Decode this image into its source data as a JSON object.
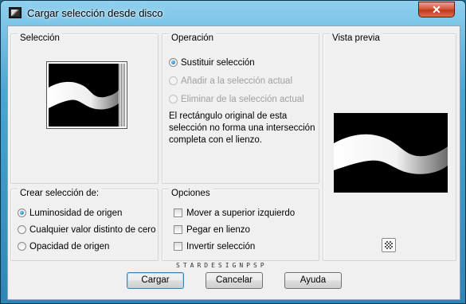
{
  "window": {
    "title": "Cargar selección desde disco",
    "close_label": "✕"
  },
  "seleccion": {
    "label": "Selección"
  },
  "operacion": {
    "label": "Operación",
    "options": [
      {
        "label": "Sustituir selección",
        "selected": true,
        "enabled": true
      },
      {
        "label": "Añadir a la selección actual",
        "selected": false,
        "enabled": false
      },
      {
        "label": "Eliminar de la selección actual",
        "selected": false,
        "enabled": false
      }
    ],
    "description": "El rectángulo original de esta selección no forma una intersección completa con el lienzo."
  },
  "vista_previa": {
    "label": "Vista previa"
  },
  "crear": {
    "label": "Crear selección de:",
    "options": [
      {
        "label": "Luminosidad de origen",
        "selected": true
      },
      {
        "label": "Cualquier valor distinto de cero",
        "selected": false
      },
      {
        "label": "Opacidad de origen",
        "selected": false
      }
    ]
  },
  "opciones": {
    "label": "Opciones",
    "items": [
      {
        "label": "Mover a superior izquierdo",
        "checked": false
      },
      {
        "label": "Pegar en lienzo",
        "checked": false
      },
      {
        "label": "Invertir selección",
        "checked": false
      }
    ]
  },
  "watermark": "STARDESIGNPSP",
  "buttons": {
    "ok": "Cargar",
    "cancel": "Cancelar",
    "help": "Ayuda"
  }
}
